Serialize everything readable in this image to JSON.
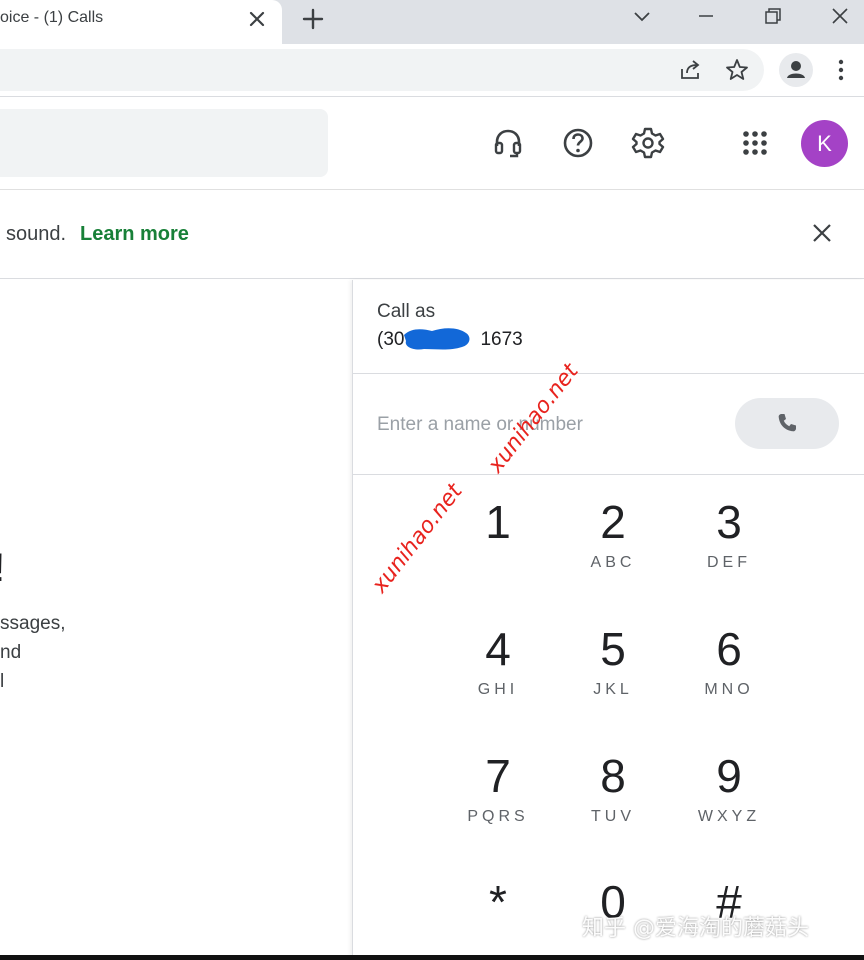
{
  "browser": {
    "tab_title": "oice - (1) Calls",
    "tab_close_icon": "close-icon",
    "new_tab_icon": "plus-icon",
    "window_controls": [
      "chevron-down-icon",
      "minimize-icon",
      "restore-icon",
      "close-icon"
    ],
    "toolbar_icons": [
      "share-icon",
      "star-icon",
      "profile-icon",
      "kebab-menu-icon"
    ]
  },
  "header": {
    "icons": [
      "headset-icon",
      "help-icon",
      "settings-icon",
      "apps-grid-icon"
    ],
    "avatar_letter": "K",
    "avatar_color": "#a442c6"
  },
  "banner": {
    "text": "sound.",
    "link_label": "Learn more",
    "link_color": "#188038"
  },
  "left_content": {
    "heading": "!",
    "lines": [
      "ssages,",
      "nd",
      "l"
    ]
  },
  "dialer": {
    "call_as_label": "Call as",
    "call_as_number": "(30",
    "call_as_number_suffix": "1673",
    "input_placeholder": "Enter a name or number",
    "call_button_icon": "phone-icon",
    "keys": [
      {
        "digit": "1",
        "letters": ""
      },
      {
        "digit": "2",
        "letters": "ABC"
      },
      {
        "digit": "3",
        "letters": "DEF"
      },
      {
        "digit": "4",
        "letters": "GHI"
      },
      {
        "digit": "5",
        "letters": "JKL"
      },
      {
        "digit": "6",
        "letters": "MNO"
      },
      {
        "digit": "7",
        "letters": "PQRS"
      },
      {
        "digit": "8",
        "letters": "TUV"
      },
      {
        "digit": "9",
        "letters": "WXYZ"
      },
      {
        "digit": "*",
        "letters": ""
      },
      {
        "digit": "0",
        "letters": ""
      },
      {
        "digit": "#",
        "letters": ""
      }
    ]
  },
  "watermarks": {
    "text1": "xunihao.net",
    "text2": "xunihao.net",
    "zh": "知乎 @爱海淘的蘑菇头"
  }
}
